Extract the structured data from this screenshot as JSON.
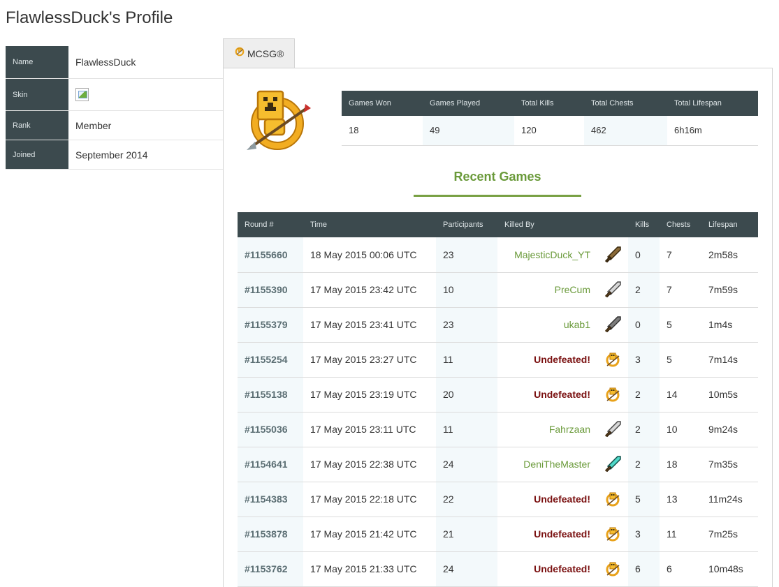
{
  "page": {
    "title": "FlawlessDuck's Profile"
  },
  "profile": {
    "name_label": "Name",
    "name_value": "FlawlessDuck",
    "skin_label": "Skin",
    "rank_label": "Rank",
    "rank_value": "Member",
    "joined_label": "Joined",
    "joined_value": "September 2014"
  },
  "tabs": [
    {
      "label": "MCSG®",
      "icon": "mcsg-logo-icon",
      "active": true
    }
  ],
  "stats": {
    "headers": [
      "Games Won",
      "Games Played",
      "Total Kills",
      "Total Chests",
      "Total Lifespan"
    ],
    "values": [
      "18",
      "49",
      "120",
      "462",
      "6h16m"
    ]
  },
  "recent_games": {
    "title": "Recent Games",
    "headers": [
      "Round #",
      "Time",
      "Participants",
      "Killed By",
      "",
      "Kills",
      "Chests",
      "Lifespan"
    ],
    "rows": [
      {
        "round": "#1155660",
        "time": "18 May 2015 00:06 UTC",
        "participants": "23",
        "killed_by": "MajesticDuck_YT",
        "icon": "wooden-sword-icon",
        "kills": "0",
        "chests": "7",
        "lifespan": "2m58s"
      },
      {
        "round": "#1155390",
        "time": "17 May 2015 23:42 UTC",
        "participants": "10",
        "killed_by": "PreCum",
        "icon": "iron-sword-icon",
        "kills": "2",
        "chests": "7",
        "lifespan": "7m59s"
      },
      {
        "round": "#1155379",
        "time": "17 May 2015 23:41 UTC",
        "participants": "23",
        "killed_by": "ukab1",
        "icon": "stone-sword-icon",
        "kills": "0",
        "chests": "5",
        "lifespan": "1m4s"
      },
      {
        "round": "#1155254",
        "time": "17 May 2015 23:27 UTC",
        "participants": "11",
        "killed_by": "Undefeated!",
        "icon": "mcsg-logo-icon",
        "kills": "3",
        "chests": "5",
        "lifespan": "7m14s"
      },
      {
        "round": "#1155138",
        "time": "17 May 2015 23:19 UTC",
        "participants": "20",
        "killed_by": "Undefeated!",
        "icon": "mcsg-logo-icon",
        "kills": "2",
        "chests": "14",
        "lifespan": "10m5s"
      },
      {
        "round": "#1155036",
        "time": "17 May 2015 23:11 UTC",
        "participants": "11",
        "killed_by": "Fahrzaan",
        "icon": "iron-sword-icon",
        "kills": "2",
        "chests": "10",
        "lifespan": "9m24s"
      },
      {
        "round": "#1154641",
        "time": "17 May 2015 22:38 UTC",
        "participants": "24",
        "killed_by": "DeniTheMaster",
        "icon": "diamond-sword-icon",
        "kills": "2",
        "chests": "18",
        "lifespan": "7m35s"
      },
      {
        "round": "#1154383",
        "time": "17 May 2015 22:18 UTC",
        "participants": "22",
        "killed_by": "Undefeated!",
        "icon": "mcsg-logo-icon",
        "kills": "5",
        "chests": "13",
        "lifespan": "11m24s"
      },
      {
        "round": "#1153878",
        "time": "17 May 2015 21:42 UTC",
        "participants": "21",
        "killed_by": "Undefeated!",
        "icon": "mcsg-logo-icon",
        "kills": "3",
        "chests": "11",
        "lifespan": "7m25s"
      },
      {
        "round": "#1153762",
        "time": "17 May 2015 21:33 UTC",
        "participants": "24",
        "killed_by": "Undefeated!",
        "icon": "mcsg-logo-icon",
        "kills": "6",
        "chests": "6",
        "lifespan": "10m48s"
      }
    ]
  },
  "colors": {
    "header_bg": "#3c4a4e",
    "accent_green": "#6a9a3a",
    "name_green": "#2e7d1f",
    "undefeated_red": "#7a1010",
    "alt_cell": "#f3f9fb"
  }
}
